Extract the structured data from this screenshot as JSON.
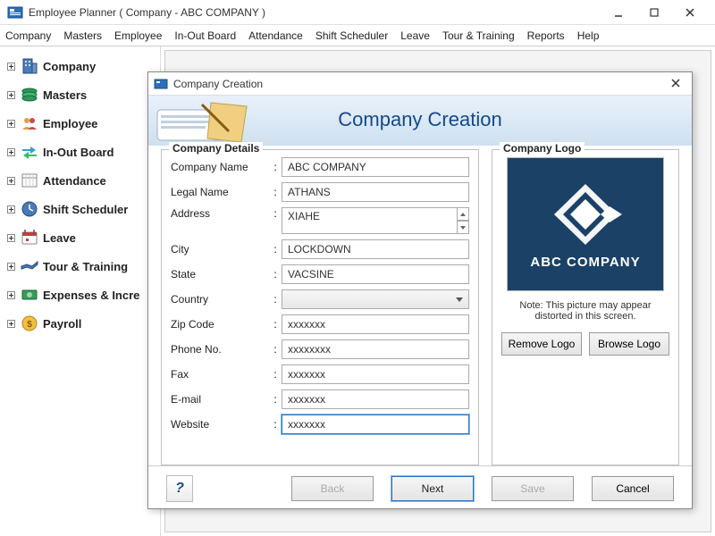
{
  "window": {
    "title": "Employee Planner ( Company - ABC COMPANY )"
  },
  "menubar": [
    "Company",
    "Masters",
    "Employee",
    "In-Out Board",
    "Attendance",
    "Shift Scheduler",
    "Leave",
    "Tour & Training",
    "Reports",
    "Help"
  ],
  "sidebar": [
    {
      "label": "Company",
      "icon": "company-icon"
    },
    {
      "label": "Masters",
      "icon": "masters-icon"
    },
    {
      "label": "Employee",
      "icon": "employee-icon"
    },
    {
      "label": "In-Out Board",
      "icon": "in-out-icon"
    },
    {
      "label": "Attendance",
      "icon": "attendance-icon"
    },
    {
      "label": "Shift Scheduler",
      "icon": "shift-icon"
    },
    {
      "label": "Leave",
      "icon": "leave-icon"
    },
    {
      "label": "Tour & Training",
      "icon": "tour-icon"
    },
    {
      "label": "Expenses & Incre",
      "icon": "expenses-icon"
    },
    {
      "label": "Payroll",
      "icon": "payroll-icon"
    }
  ],
  "dialog": {
    "title": "Company Creation",
    "banner_title": "Company Creation",
    "fieldset_details": "Company Details",
    "fieldset_logo": "Company Logo",
    "fields": {
      "company_name": {
        "label": "Company Name",
        "value": "ABC COMPANY"
      },
      "legal_name": {
        "label": "Legal Name",
        "value": "ATHANS"
      },
      "address": {
        "label": "Address",
        "value": "XIAHE"
      },
      "city": {
        "label": "City",
        "value": "LOCKDOWN"
      },
      "state": {
        "label": "State",
        "value": "VACSINE"
      },
      "country": {
        "label": "Country",
        "value": ""
      },
      "zip": {
        "label": "Zip Code",
        "value": "xxxxxxx"
      },
      "phone": {
        "label": "Phone No.",
        "value": "xxxxxxxx"
      },
      "fax": {
        "label": "Fax",
        "value": "xxxxxxx"
      },
      "email": {
        "label": "E-mail",
        "value": "xxxxxxx"
      },
      "website": {
        "label": "Website",
        "value": "xxxxxxx"
      }
    },
    "logo": {
      "company_text": "ABC COMPANY",
      "note": "Note: This picture may appear distorted in this screen.",
      "remove": "Remove Logo",
      "browse": "Browse Logo"
    },
    "buttons": {
      "help": "?",
      "back": "Back",
      "next": "Next",
      "save": "Save",
      "cancel": "Cancel"
    }
  }
}
